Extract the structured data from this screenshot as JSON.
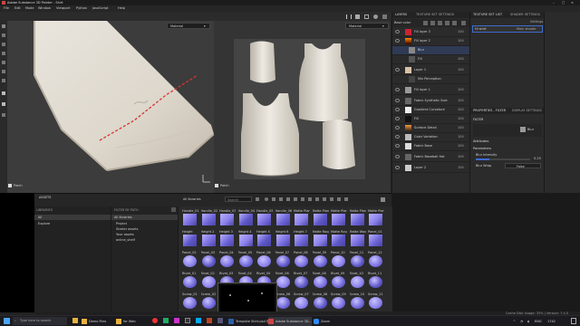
{
  "window": {
    "title": "Adobe Substance 3D Painter - Shirt"
  },
  "menu": [
    "File",
    "Edit",
    "Mode",
    "Window",
    "Viewport",
    "Python",
    "JavaScript",
    "Help"
  ],
  "viewport3d": {
    "dropdown": "Material"
  },
  "viewport2d": {
    "dropdown": "Material"
  },
  "viewport_labels": [
    "Patch",
    "Patch"
  ],
  "layers": {
    "tabs": [
      "LAYERS",
      "TEXTURE SET SETTINGS"
    ],
    "channel": "Base color",
    "rows": [
      {
        "name": "Fill layer 3",
        "val": "100"
      },
      {
        "name": "Fill layer 2",
        "val": "100"
      },
      {
        "name": "Blur",
        "val": ""
      },
      {
        "name": "Fill",
        "val": "100"
      },
      {
        "name": "Layer 1",
        "val": "100"
      },
      {
        "name": "Mix Perception",
        "val": ""
      },
      {
        "name": "Fill layer 1",
        "val": "100"
      },
      {
        "name": "Fabric Synthetic Sole",
        "val": "100"
      },
      {
        "name": "Gradient Curvature",
        "val": "100"
      },
      {
        "name": "Fill",
        "val": "100"
      },
      {
        "name": "Surface Detail",
        "val": "100"
      },
      {
        "name": "Color Variation",
        "val": "100"
      },
      {
        "name": "Fabric Base",
        "val": "100"
      },
      {
        "name": "Fabric Baseball Hat",
        "val": "100"
      },
      {
        "name": "Layer 2",
        "val": "100"
      }
    ]
  },
  "texture_set_list": {
    "tabs": [
      "TEXTURE SET LIST",
      "SHADER SETTINGS"
    ],
    "settings_label": "Settings",
    "item": "Hi shirt",
    "item_shader": "Main shader"
  },
  "properties": {
    "tabs": [
      "PROPERTIES - FILTER",
      "DISPLAY SETTINGS"
    ],
    "section": "FILTER",
    "filter_name": "Blur",
    "attributes": "Attributes",
    "parameters": "Parameters",
    "blur_intensity_label": "Blur Intensity",
    "blur_intensity_value": "0.25",
    "blur_wrap_label": "Blur Wrap",
    "blur_wrap_value": "False"
  },
  "assets": {
    "title": "ASSETS",
    "search_placeholder": "Search",
    "tree": [
      "All",
      "Explore"
    ],
    "filters_header": "FILTER BY PATH",
    "filters": [
      "All libraries",
      "Project",
      "Starter assets",
      "Your assets",
      "online_shelf"
    ],
    "library_header": "All libraries",
    "tiles": [
      "Handle_01",
      "Handle_02",
      "Handle_03",
      "Handle_04",
      "Handle_05",
      "Handle_06",
      "Matte Plane",
      "Matte Plane",
      "Matte Plane",
      "Matte Plane",
      "Matte Plane",
      "Height",
      "Height 2",
      "Height 3",
      "Height 4",
      "Height 5",
      "Height 6",
      "Height 7",
      "Matte Rough",
      "Matte Round",
      "Matte Wave",
      "Panel_01",
      "Panel_02",
      "Panel_03",
      "Panel_04",
      "Panel_05",
      "Panel_06",
      "Panel_07",
      "Panel_08",
      "Panel_09",
      "Panel_10",
      "Panel_11",
      "Panel_12",
      "Rivet_01",
      "Rivet_02",
      "Rivet_03",
      "Rivet_04",
      "Rivet_05",
      "Rivet_06",
      "Rivet_07",
      "Rivet_08",
      "Rivet_09",
      "Rivet_10",
      "Rivet_11",
      "Screw_01",
      "Screw_02",
      "Screw_03",
      "Screw_04",
      "Screw_05",
      "Screw_06",
      "Screw_07",
      "Screw_08",
      "Screw_09",
      "Screw_10",
      "Screw_11"
    ]
  },
  "status": {
    "cache": "Cache Disk Usage: 33% | Version: 7.4.0"
  },
  "taskbar": {
    "search": "Type here to search",
    "apps": [
      "Demo Files",
      "for Web",
      "Template Shirt.psd @ ...",
      "Adobe Substance 3D...",
      "Zoom"
    ],
    "time": "1742",
    "lang": "ENG"
  },
  "colors": {
    "accent": "#3e6bd1",
    "panel": "#2b2b2b",
    "normal_map": "#7a6fe0"
  }
}
